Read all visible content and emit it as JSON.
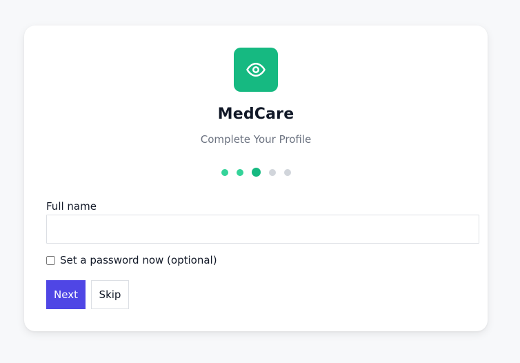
{
  "brand": {
    "name": "MedCare",
    "icon": "eye-icon",
    "color": "#16b981"
  },
  "header": {
    "subtitle": "Complete Your Profile"
  },
  "progress": {
    "total_steps": 5,
    "current_step": 3
  },
  "form": {
    "full_name_label": "Full name",
    "full_name_value": "",
    "set_password_label": "Set a password now (optional)",
    "set_password_checked": false
  },
  "actions": {
    "next_label": "Next",
    "skip_label": "Skip",
    "primary_color": "#4f46e5"
  }
}
